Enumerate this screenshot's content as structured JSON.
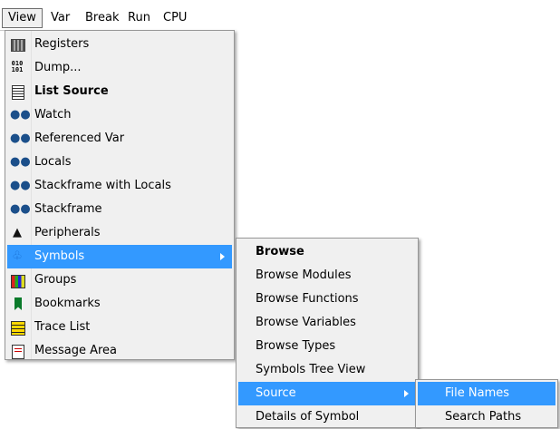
{
  "menubar": {
    "items": [
      {
        "label": "View",
        "active": true
      },
      {
        "label": "Var"
      },
      {
        "label": "Break"
      },
      {
        "label": "Run"
      },
      {
        "label": "CPU"
      }
    ]
  },
  "view_menu": {
    "items": [
      {
        "label": "Registers",
        "icon": "registers-icon"
      },
      {
        "label": "Dump...",
        "icon": "dump-icon"
      },
      {
        "label": "List Source",
        "icon": "list-source-icon",
        "bold": true
      },
      {
        "label": "Watch",
        "icon": "watch-icon"
      },
      {
        "label": "Referenced Var",
        "icon": "referenced-var-icon"
      },
      {
        "label": "Locals",
        "icon": "locals-icon"
      },
      {
        "label": "Stackframe with Locals",
        "icon": "stackframe-locals-icon"
      },
      {
        "label": "Stackframe",
        "icon": "stackframe-icon"
      },
      {
        "label": "Peripherals",
        "icon": "peripherals-icon"
      },
      {
        "label": "Symbols",
        "icon": "symbols-icon",
        "highlighted": true,
        "submenu": true
      },
      {
        "label": "Groups",
        "icon": "groups-icon"
      },
      {
        "label": "Bookmarks",
        "icon": "bookmarks-icon"
      },
      {
        "label": "Trace List",
        "icon": "trace-list-icon"
      },
      {
        "label": "Message Area",
        "icon": "message-area-icon"
      }
    ]
  },
  "symbols_menu": {
    "items": [
      {
        "label": "Browse",
        "bold": true
      },
      {
        "label": "Browse Modules"
      },
      {
        "label": "Browse Functions"
      },
      {
        "label": "Browse Variables"
      },
      {
        "label": "Browse Types"
      },
      {
        "label": "Symbols Tree View"
      },
      {
        "label": "Source",
        "highlighted": true,
        "submenu": true
      },
      {
        "label": "Details of Symbol"
      }
    ]
  },
  "source_menu": {
    "items": [
      {
        "label": "File Names",
        "highlighted": true
      },
      {
        "label": "Search Paths"
      }
    ]
  },
  "colors": {
    "menu_bg": "#f0f0f0",
    "highlight": "#3399ff",
    "highlight_text": "#ffffff"
  }
}
